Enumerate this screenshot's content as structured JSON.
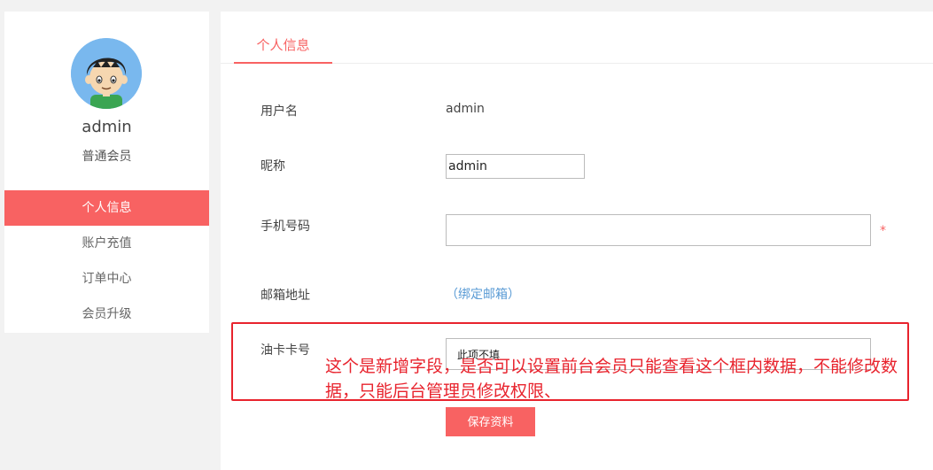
{
  "sidebar": {
    "username": "admin",
    "level": "普通会员",
    "menu": [
      {
        "label": "个人信息",
        "active": true
      },
      {
        "label": "账户充值",
        "active": false
      },
      {
        "label": "订单中心",
        "active": false
      },
      {
        "label": "会员升级",
        "active": false
      }
    ]
  },
  "main": {
    "tab_label": "个人信息",
    "fields": {
      "username_label": "用户名",
      "username_value": "admin",
      "nickname_label": "昵称",
      "nickname_value": "admin",
      "phone_label": "手机号码",
      "phone_value": "",
      "phone_required": "*",
      "email_label": "邮箱地址",
      "email_link": "（绑定邮箱）",
      "card_label": "油卡卡号",
      "card_value": "此项不填"
    },
    "save_label": "保存资料"
  },
  "annotation": {
    "text": "这个是新增字段，是否可以设置前台会员只能查看这个框内数据，不能修改数据，只能后台管理员修改权限、"
  },
  "colors": {
    "accent": "#f86262",
    "annotation": "#e8232d",
    "link": "#5a9bd5",
    "avatar_bg": "#79b8ee"
  }
}
